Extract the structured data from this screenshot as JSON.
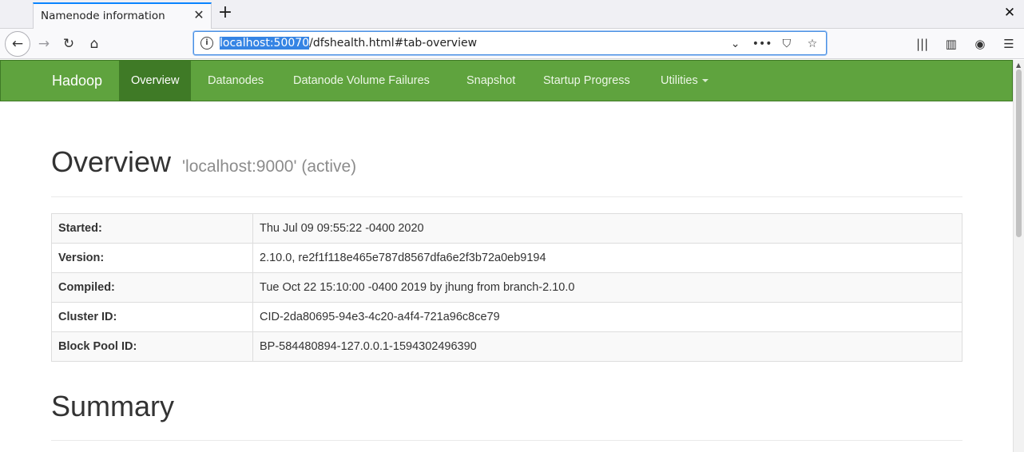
{
  "browser": {
    "tab_title": "Namenode information",
    "tab_close": "✕",
    "new_tab": "+",
    "window_close": "✕",
    "url_host": "localhost:50070",
    "url_rest": "/dfshealth.html#tab-overview",
    "icons": {
      "info": "i",
      "back": "←",
      "forward": "→",
      "reload": "↻",
      "home": "⌂",
      "dropdown": "⌄",
      "more": "•••",
      "pocket": "⛉",
      "bookmark": "☆",
      "library": "|||",
      "sidebar": "▥",
      "account": "◉",
      "menu": "☰"
    }
  },
  "nav": {
    "brand": "Hadoop",
    "items": [
      {
        "label": "Overview"
      },
      {
        "label": "Datanodes"
      },
      {
        "label": "Datanode Volume Failures"
      },
      {
        "label": "Snapshot"
      },
      {
        "label": "Startup Progress"
      },
      {
        "label": "Utilities"
      }
    ]
  },
  "overview": {
    "title": "Overview",
    "subtitle": "'localhost:9000' (active)",
    "rows": [
      {
        "label": "Started:",
        "value": "Thu Jul 09 09:55:22 -0400 2020"
      },
      {
        "label": "Version:",
        "value": "2.10.0, re2f1f118e465e787d8567dfa6e2f3b72a0eb9194"
      },
      {
        "label": "Compiled:",
        "value": "Tue Oct 22 15:10:00 -0400 2019 by jhung from branch-2.10.0"
      },
      {
        "label": "Cluster ID:",
        "value": "CID-2da80695-94e3-4c20-a4f4-721a96c8ce79"
      },
      {
        "label": "Block Pool ID:",
        "value": "BP-584480894-127.0.0.1-1594302496390"
      }
    ]
  },
  "summary": {
    "title": "Summary"
  },
  "colors": {
    "navbar": "#5fa33e",
    "navbar_active": "#3f7a26",
    "url_highlight": "#3584e4"
  }
}
